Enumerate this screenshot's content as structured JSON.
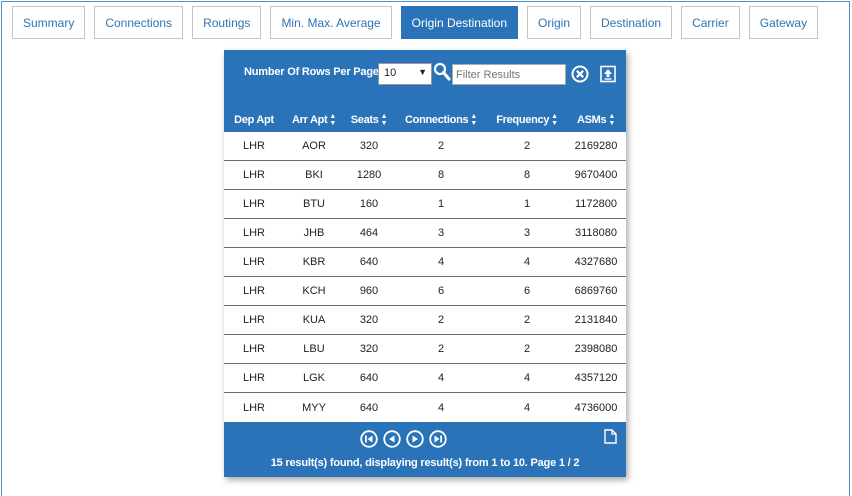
{
  "tabs": [
    {
      "label": "Summary",
      "active": false
    },
    {
      "label": "Connections",
      "active": false
    },
    {
      "label": "Routings",
      "active": false
    },
    {
      "label": "Min. Max. Average",
      "active": false
    },
    {
      "label": "Origin Destination",
      "active": true
    },
    {
      "label": "Origin",
      "active": false
    },
    {
      "label": "Destination",
      "active": false
    },
    {
      "label": "Carrier",
      "active": false
    },
    {
      "label": "Gateway",
      "active": false
    }
  ],
  "controls": {
    "rows_label": "Number Of Rows Per Page",
    "rows_value": "10",
    "filter_placeholder": "Filter Results"
  },
  "table": {
    "columns": [
      "Dep Apt",
      "Arr Apt",
      "Seats",
      "Connections",
      "Frequency",
      "ASMs"
    ],
    "rows": [
      [
        "LHR",
        "AOR",
        "320",
        "2",
        "2",
        "2169280"
      ],
      [
        "LHR",
        "BKI",
        "1280",
        "8",
        "8",
        "9670400"
      ],
      [
        "LHR",
        "BTU",
        "160",
        "1",
        "1",
        "1172800"
      ],
      [
        "LHR",
        "JHB",
        "464",
        "3",
        "3",
        "3118080"
      ],
      [
        "LHR",
        "KBR",
        "640",
        "4",
        "4",
        "4327680"
      ],
      [
        "LHR",
        "KCH",
        "960",
        "6",
        "6",
        "6869760"
      ],
      [
        "LHR",
        "KUA",
        "320",
        "2",
        "2",
        "2131840"
      ],
      [
        "LHR",
        "LBU",
        "320",
        "2",
        "2",
        "2398080"
      ],
      [
        "LHR",
        "LGK",
        "640",
        "4",
        "4",
        "4357120"
      ],
      [
        "LHR",
        "MYY",
        "640",
        "4",
        "4",
        "4736000"
      ]
    ]
  },
  "footer": {
    "result_text": "15 result(s) found, displaying result(s) from 1 to 10. Page 1 / 2"
  },
  "colors": {
    "accent": "#2b73b9",
    "tab_text": "#2f74b5",
    "frame_border": "#4f8fc9"
  },
  "icons": {
    "search": "search-icon",
    "clear": "clear-filter-icon",
    "export": "export-icon",
    "first": "first-page-icon",
    "prev": "prev-page-icon",
    "next": "next-page-icon",
    "last": "last-page-icon",
    "document": "document-icon"
  }
}
